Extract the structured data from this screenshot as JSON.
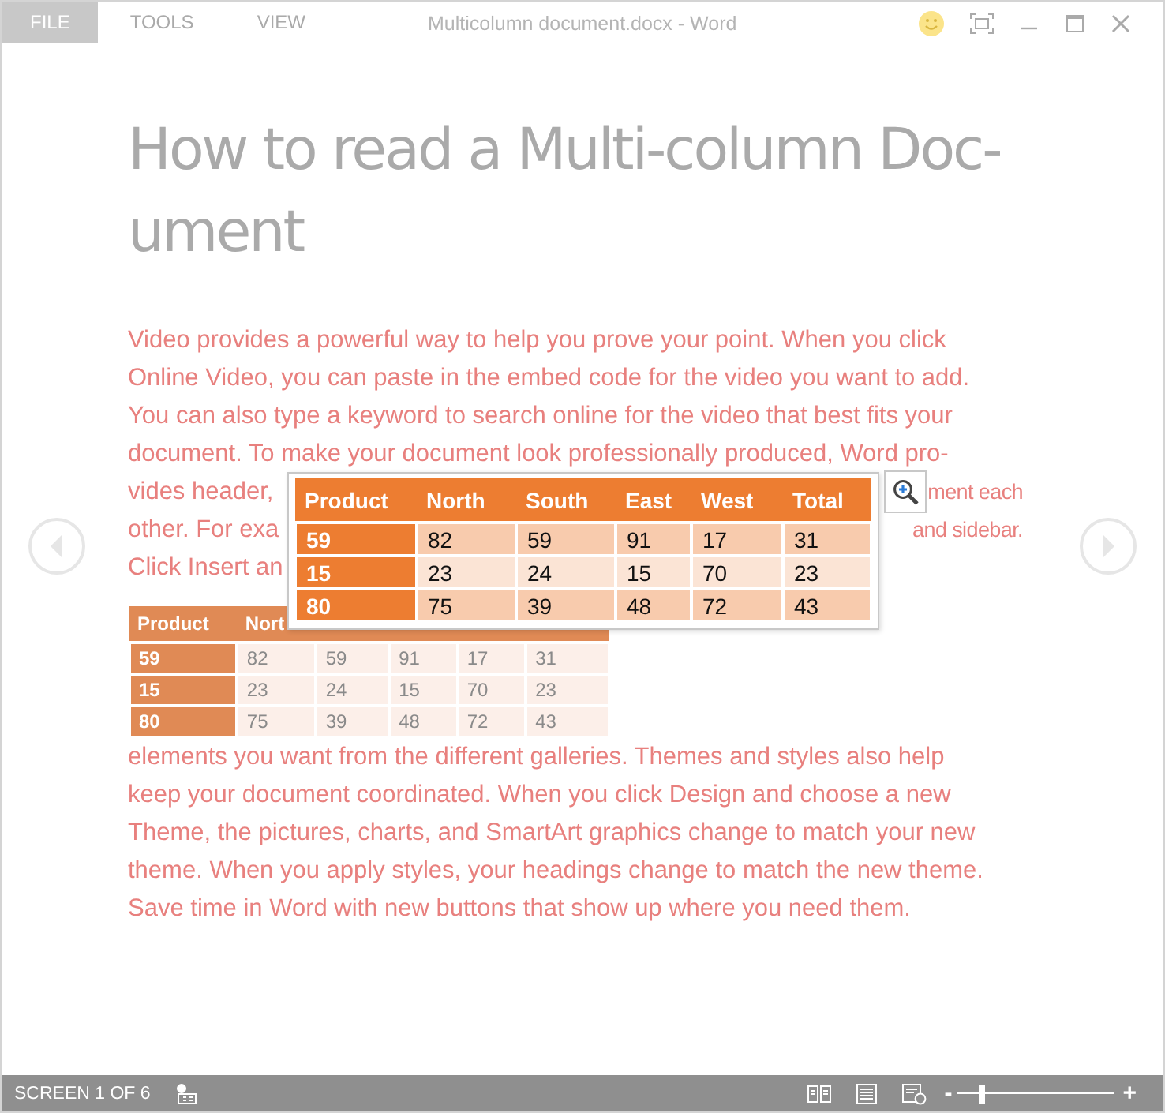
{
  "menu_tabs": [
    {
      "label": "FILE",
      "selected": true
    },
    {
      "label": "TOOLS",
      "selected": false
    },
    {
      "label": "VIEW",
      "selected": false
    }
  ],
  "window": {
    "title": "Multicolumn document.docx - Word"
  },
  "document": {
    "heading_lines": [
      "How to read a Multi-column Doc-",
      "ument"
    ],
    "lines_before": [
      {
        "left": "Video provides a powerful way to help you prove your point. When you click"
      },
      {
        "left": "Online Video, you can paste in the embed code for the video you want to add."
      },
      {
        "left": "You can also type a keyword to search online for the video that best fits your"
      },
      {
        "left": "document. To make your document look professionally produced, Word pro-"
      },
      {
        "left": "vides header,",
        "right": "ment each"
      },
      {
        "left": "other. For exa",
        "right": "and sidebar."
      },
      {
        "left": "Click Insert an"
      }
    ],
    "background_table": {
      "columns": [
        "Product",
        "Nort"
      ],
      "rows": [
        [
          "59",
          "82",
          "59",
          "91",
          "17",
          "31"
        ],
        [
          "15",
          "23",
          "24",
          "15",
          "70",
          "23"
        ],
        [
          "80",
          "75",
          "39",
          "48",
          "72",
          "43"
        ]
      ]
    },
    "lines_after": [
      "elements you want from the different galleries. Themes and styles also help",
      "keep your document coordinated. When you click Design and choose a new",
      "Theme, the pictures, charts, and SmartArt graphics change to match your new",
      "theme. When you apply styles, your headings change to match the new theme.",
      "Save time in Word with new buttons that show up where you need them."
    ]
  },
  "popup_table": {
    "columns": [
      "Product",
      "North",
      "South",
      "East",
      "West",
      "Total"
    ],
    "rows": [
      [
        "59",
        "82",
        "59",
        "91",
        "17",
        "31"
      ],
      [
        "15",
        "23",
        "24",
        "15",
        "70",
        "23"
      ],
      [
        "80",
        "75",
        "39",
        "48",
        "72",
        "43"
      ]
    ]
  },
  "status_bar": {
    "screen": "SCREEN 1 OF 6",
    "zoom": {
      "minus": "-",
      "plus": "+",
      "level": 0.16
    }
  }
}
